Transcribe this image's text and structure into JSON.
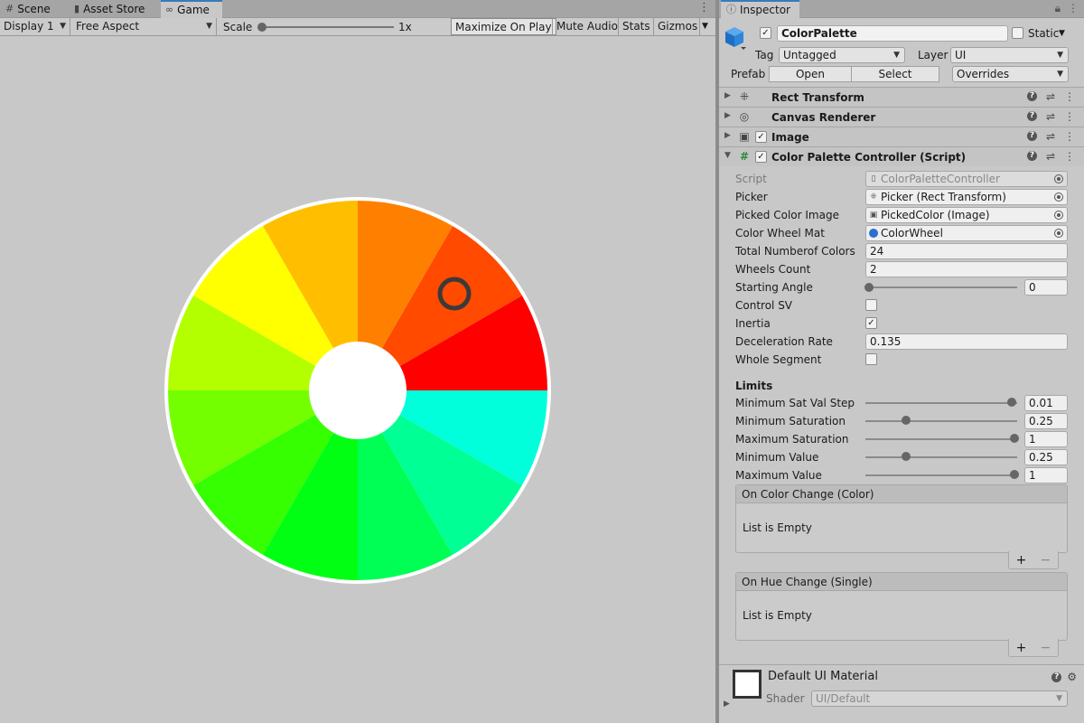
{
  "tabs": {
    "scene": "Scene",
    "asset_store": "Asset Store",
    "game": "Game"
  },
  "game_toolbar": {
    "display": "Display 1",
    "aspect": "Free Aspect",
    "scale_label": "Scale",
    "scale_value": "1x",
    "scale_slider_fraction": 0.0,
    "maximize_on_play": "Maximize On Play",
    "mute_audio": "Mute Audio",
    "stats": "Stats",
    "gizmos": "Gizmos"
  },
  "color_wheel": {
    "segments_clockwise_from_right": [
      "#ff0000",
      "#ff4a00",
      "#ff8000",
      "#ffbf00",
      "#ffff00",
      "#b3ff00",
      "#73ff00",
      "#35ff00",
      "#00ff13",
      "#00ff55",
      "#00ff95",
      "#00ffda"
    ],
    "picker_color": "#3a3a3a",
    "rim_color": "#ffffff"
  },
  "inspector": {
    "title": "Inspector",
    "object_name": "ColorPalette",
    "active_checked": true,
    "static_label": "Static",
    "tag_label": "Tag",
    "tag_value": "Untagged",
    "layer_label": "Layer",
    "layer_value": "UI",
    "prefab_label": "Prefab",
    "open_label": "Open",
    "select_label": "Select",
    "overrides_label": "Overrides",
    "components": {
      "rect_transform": "Rect Transform",
      "canvas_renderer": "Canvas Renderer",
      "image": "Image",
      "script": "Color Palette Controller (Script)"
    },
    "props": {
      "script_label": "Script",
      "script_value": "ColorPaletteController",
      "picker_label": "Picker",
      "picker_value": "Picker (Rect Transform)",
      "picked_color_image_label": "Picked Color Image",
      "picked_color_image_value": "PickedColor (Image)",
      "color_wheel_mat_label": "Color Wheel Mat",
      "color_wheel_mat_value": "ColorWheel",
      "total_colors_label": "Total Numberof Colors",
      "total_colors_value": "24",
      "wheels_count_label": "Wheels Count",
      "wheels_count_value": "2",
      "starting_angle_label": "Starting Angle",
      "starting_angle_value": "0",
      "control_sv_label": "Control SV",
      "control_sv_checked": false,
      "inertia_label": "Inertia",
      "inertia_checked": true,
      "deceleration_label": "Deceleration Rate",
      "deceleration_value": "0.135",
      "whole_segment_label": "Whole Segment",
      "whole_segment_checked": false
    },
    "limits": {
      "header": "Limits",
      "min_sat_val_step_label": "Minimum Sat Val Step",
      "min_sat_val_step_value": "0.01",
      "min_sat_label": "Minimum Saturation",
      "min_sat_value": "0.25",
      "max_sat_label": "Maximum Saturation",
      "max_sat_value": "1",
      "min_value_label": "Minimum Value",
      "min_value_value": "0.25",
      "max_value_label": "Maximum Value",
      "max_value_value": "1"
    },
    "events": {
      "on_color_change": "On Color Change (Color)",
      "on_hue_change": "On Hue Change (Single)",
      "empty": "List is Empty",
      "plus": "+",
      "minus": "−"
    },
    "material": {
      "name": "Default UI Material",
      "shader_label": "Shader",
      "shader_value": "UI/Default"
    }
  }
}
